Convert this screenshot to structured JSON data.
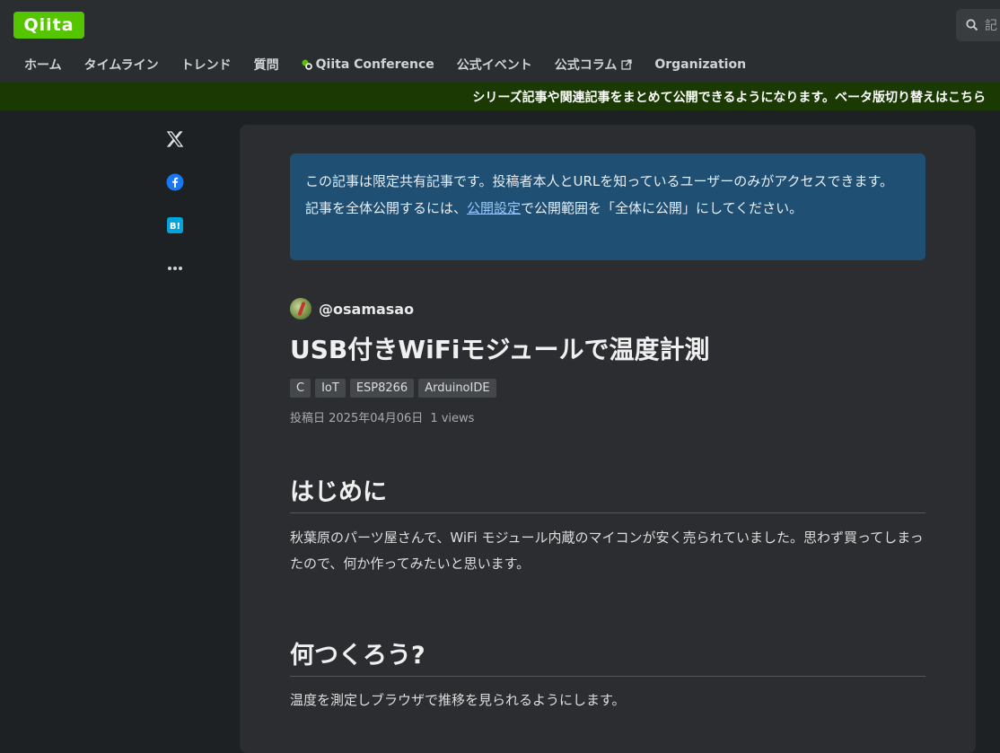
{
  "header": {
    "logo": "Qiita",
    "search_placeholder": "記",
    "nav": [
      {
        "label": "ホーム"
      },
      {
        "label": "タイムライン"
      },
      {
        "label": "トレンド"
      },
      {
        "label": "質問"
      },
      {
        "label": "Qiita Conference"
      },
      {
        "label": "公式イベント"
      },
      {
        "label": "公式コラム"
      },
      {
        "label": "Organization"
      }
    ],
    "accent_color": "#55c500"
  },
  "banner": {
    "text": "シリーズ記事や関連記事をまとめて公開できるようになります。ベータ版切り替えはこちら"
  },
  "share_icons": [
    "x-icon",
    "facebook-icon",
    "hatena-bookmark-icon",
    "more-icon"
  ],
  "notice": {
    "line1": "この記事は限定共有記事です。投稿者本人とURLを知っているユーザーのみがアクセスできます。",
    "line2_pre": "記事を全体公開するには、",
    "line2_link": "公開設定",
    "line2_post": "で公開範囲を「全体に公開」にしてください。"
  },
  "article": {
    "author": "@osamasao",
    "title": "USB付きWiFiモジュールで温度計測",
    "tags": [
      "C",
      "IoT",
      "ESP8266",
      "ArduinoIDE"
    ],
    "posted": "投稿日 2025年04月06日",
    "views": "1 views",
    "sections": [
      {
        "heading": "はじめに",
        "body": "秋葉原のパーツ屋さんで、WiFi モジュール内蔵のマイコンが安く売られていました。思わず買ってしまったので、何か作ってみたいと思います。"
      },
      {
        "heading": "何つくろう?",
        "body": "温度を測定しブラウザで推移を見られるようにします。"
      }
    ]
  }
}
